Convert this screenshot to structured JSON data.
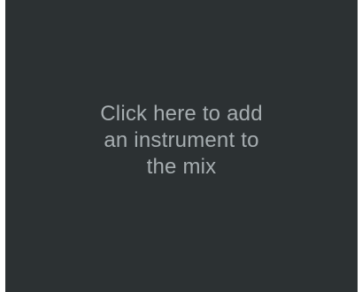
{
  "empty_slot": {
    "prompt_lines": [
      "Click here to add",
      "an instrument to",
      "the mix"
    ]
  },
  "colors": {
    "panel_background": "#2c3133",
    "prompt_text": "#a6adb0",
    "outer_background": "#ffffff"
  }
}
